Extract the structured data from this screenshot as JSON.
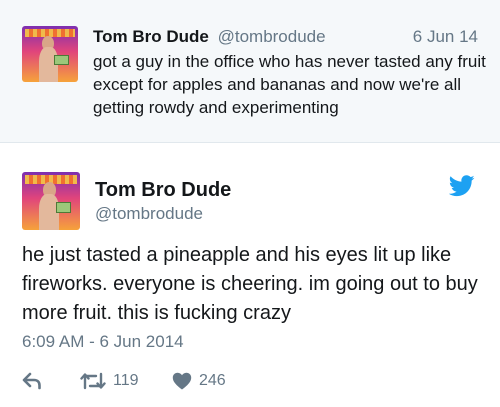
{
  "parent_tweet": {
    "name": "Tom Bro Dude",
    "handle": "@tombrodude",
    "date": "6 Jun 14",
    "text": "got a guy in the office who has never tasted any fruit except for apples and bananas and now we're all getting rowdy and experimenting"
  },
  "main_tweet": {
    "name": "Tom Bro Dude",
    "handle": "@tombrodude",
    "text": "he just tasted a pineapple and his eyes lit up like fireworks. everyone is cheering. im going out to buy more fruit. this is fucking crazy",
    "timestamp": "6:09 AM - 6 Jun 2014",
    "retweets": "119",
    "likes": "246"
  },
  "icons": {
    "brand": "twitter-bird-icon",
    "reply": "reply-icon",
    "retweet": "retweet-icon",
    "like": "heart-icon"
  },
  "colors": {
    "twitter_blue": "#1da1f2",
    "secondary_text": "#657786",
    "parent_background": "#f5f8fa"
  }
}
